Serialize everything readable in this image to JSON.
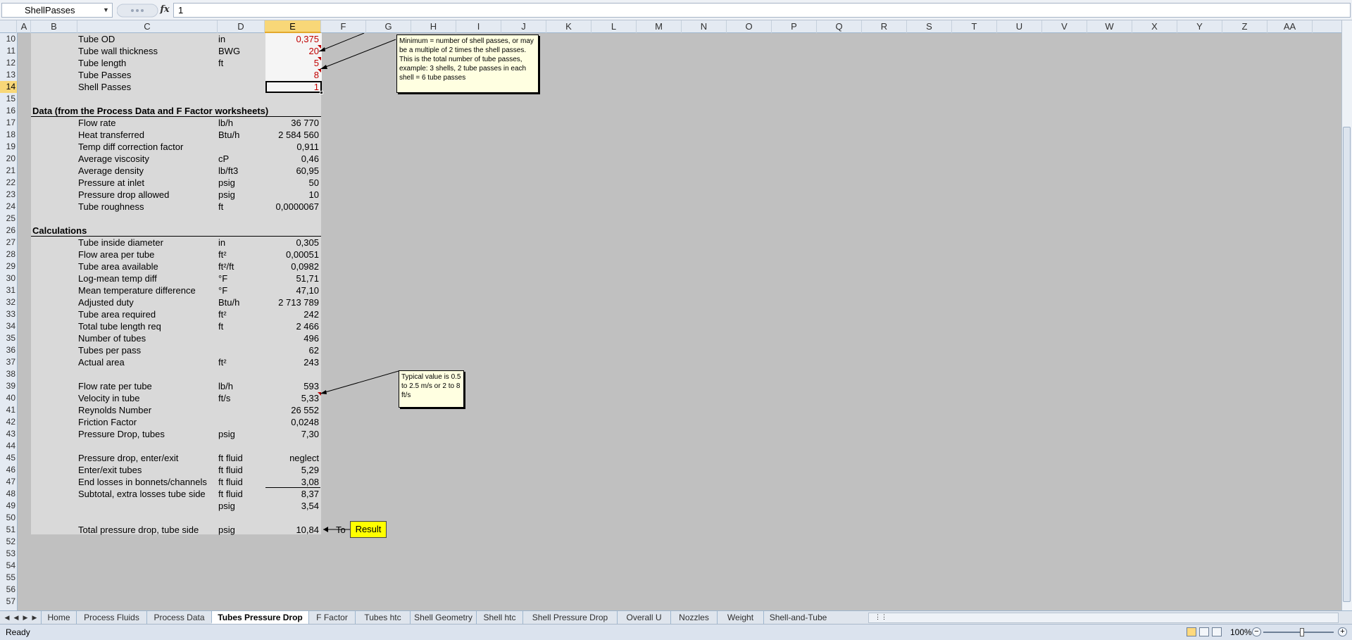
{
  "formula_bar": {
    "name_box": "ShellPasses",
    "fx_label": "fx",
    "formula": "1"
  },
  "columns": [
    "A",
    "B",
    "C",
    "D",
    "E",
    "F",
    "G",
    "H",
    "I",
    "J",
    "K",
    "L",
    "M",
    "N",
    "O",
    "P",
    "Q",
    "R",
    "S",
    "T",
    "U",
    "V",
    "W",
    "X",
    "Y",
    "Z",
    "AA"
  ],
  "rows": [
    "10",
    "11",
    "12",
    "13",
    "14",
    "15",
    "16",
    "17",
    "18",
    "19",
    "20",
    "21",
    "22",
    "23",
    "24",
    "25",
    "26",
    "27",
    "28",
    "29",
    "30",
    "31",
    "32",
    "33",
    "34",
    "35",
    "36",
    "37",
    "38",
    "39",
    "40",
    "41",
    "42",
    "43",
    "44",
    "45",
    "46",
    "47",
    "48",
    "49",
    "50",
    "51",
    "52",
    "53",
    "54",
    "55",
    "56",
    "57"
  ],
  "sheet": {
    "r10": {
      "label": "Tube OD",
      "unit": "in",
      "value": "0,375"
    },
    "r11": {
      "label": "Tube wall thickness",
      "unit": "BWG",
      "value": "20"
    },
    "r12": {
      "label": "Tube length",
      "unit": "ft",
      "value": "5"
    },
    "r13": {
      "label": "Tube Passes",
      "unit": "",
      "value": "8"
    },
    "r14": {
      "label": "Shell Passes",
      "unit": "",
      "value": "1"
    },
    "r16": {
      "heading": "Data (from the Process Data and F Factor worksheets)"
    },
    "r17": {
      "label": "Flow rate",
      "unit": "lb/h",
      "value": "36 770"
    },
    "r18": {
      "label": "Heat transferred",
      "unit": "Btu/h",
      "value": "2 584 560"
    },
    "r19": {
      "label": "Temp diff correction factor",
      "unit": "",
      "value": "0,911"
    },
    "r20": {
      "label": "Average viscosity",
      "unit": "cP",
      "value": "0,46"
    },
    "r21": {
      "label": "Average density",
      "unit": "lb/ft3",
      "value": "60,95"
    },
    "r22": {
      "label": "Pressure at inlet",
      "unit": "psig",
      "value": "50"
    },
    "r23": {
      "label": "Pressure drop allowed",
      "unit": "psig",
      "value": "10"
    },
    "r24": {
      "label": "Tube roughness",
      "unit": "ft",
      "value": "0,0000067"
    },
    "r26": {
      "heading": "Calculations"
    },
    "r27": {
      "label": "Tube inside diameter",
      "unit": "in",
      "value": "0,305"
    },
    "r28": {
      "label": "Flow area per tube",
      "unit": "ft²",
      "value": "0,00051"
    },
    "r29": {
      "label": "Tube area available",
      "unit": "ft²/ft",
      "value": "0,0982"
    },
    "r30": {
      "label": "Log-mean temp diff",
      "unit": "°F",
      "value": "51,71"
    },
    "r31": {
      "label": "Mean temperature difference",
      "unit": "°F",
      "value": "47,10"
    },
    "r32": {
      "label": "Adjusted duty",
      "unit": "Btu/h",
      "value": "2 713 789"
    },
    "r33": {
      "label": "Tube area required",
      "unit": "ft²",
      "value": "242"
    },
    "r34": {
      "label": "Total tube length req",
      "unit": "ft",
      "value": "2 466"
    },
    "r35": {
      "label": "Number of tubes",
      "unit": "",
      "value": "496"
    },
    "r36": {
      "label": "Tubes per pass",
      "unit": "",
      "value": "62"
    },
    "r37": {
      "label": "Actual area",
      "unit": "ft²",
      "value": "243"
    },
    "r39": {
      "label": "Flow rate per tube",
      "unit": "lb/h",
      "value": "593"
    },
    "r40": {
      "label": "Velocity in tube",
      "unit": "ft/s",
      "value": "5,33"
    },
    "r41": {
      "label": "Reynolds Number",
      "unit": "",
      "value": "26 552"
    },
    "r42": {
      "label": "Friction Factor",
      "unit": "",
      "value": "0,0248"
    },
    "r43": {
      "label": "Pressure Drop, tubes",
      "unit": "psig",
      "value": "7,30"
    },
    "r45": {
      "label": "Pressure drop, enter/exit",
      "unit": "ft fluid",
      "value": "neglect"
    },
    "r46": {
      "label": "Enter/exit tubes",
      "unit": "ft fluid",
      "value": "5,29"
    },
    "r47": {
      "label": "End losses in bonnets/channels",
      "unit": "ft fluid",
      "value": "3,08"
    },
    "r48": {
      "label": "Subtotal, extra losses tube side",
      "unit": "ft fluid",
      "value": "8,37"
    },
    "r49": {
      "label": "",
      "unit": "psig",
      "value": "3,54"
    },
    "r51": {
      "label": "Total pressure drop, tube side",
      "unit": "psig",
      "value": "10,84",
      "pointer": "To"
    }
  },
  "notes": {
    "shell_passes": "Minimum = number of shell passes, or may be a multiple of 2 times the shell passes. This is the total number of tube passes, example: 3 shells, 2 tube passes in each shell = 6 tube passes",
    "velocity": "Typical value is 0.5 to 2.5 m/s or 2 to 8 ft/s"
  },
  "result_button": "Result",
  "tabs": [
    "Home",
    "Process Fluids",
    "Process Data",
    "Tubes Pressure Drop",
    "F Factor",
    "Tubes htc",
    "Shell Geometry",
    "Shell htc",
    "Shell Pressure Drop",
    "Overall U",
    "Nozzles",
    "Weight",
    "Shell-and-Tube"
  ],
  "active_tab": "Tubes Pressure Drop",
  "status": {
    "mode": "Ready",
    "zoom": "100%"
  },
  "colors": {
    "input_text": "#c00000",
    "comment_bg": "#ffffe1",
    "result_bg": "#ffff00",
    "selected_header": "#f8d778"
  }
}
